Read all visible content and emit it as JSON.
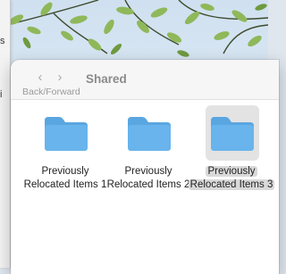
{
  "window": {
    "title": "Shared",
    "nav_caption": "Back/Forward",
    "back_glyph": "‹",
    "forward_glyph": "›"
  },
  "folders": [
    {
      "line1": "Previously",
      "line2": "Relocated Items 1",
      "selected": false,
      "icon": "folder-icon"
    },
    {
      "line1": "Previously",
      "line2": "Relocated Items 2",
      "selected": false,
      "icon": "folder-icon"
    },
    {
      "line1": "Previously",
      "line2": "Relocated Items 3",
      "selected": true,
      "icon": "folder-icon"
    }
  ],
  "back_window": {
    "chars": [
      "s",
      "i"
    ]
  },
  "colors": {
    "folder_front": "#69b4ec",
    "folder_back": "#5aa6e0",
    "selection": "#e3e3e3"
  }
}
